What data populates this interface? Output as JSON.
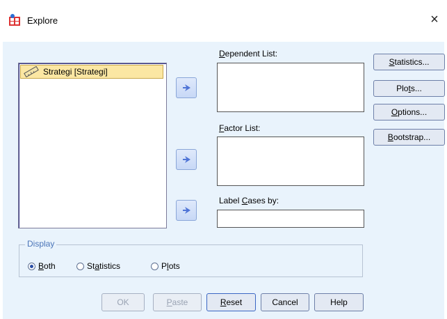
{
  "window": {
    "title": "Explore",
    "close_glyph": "×"
  },
  "variables": [
    {
      "label": "Strategi [Strategi]",
      "icon": "scale-ruler-icon"
    }
  ],
  "fields": {
    "dependent_label_pre": "D",
    "dependent_label_post": "ependent List:",
    "factor_label_pre": "F",
    "factor_label_post": "actor List:",
    "label_cases_pre": "Label ",
    "label_cases_ul": "C",
    "label_cases_post": "ases by:"
  },
  "side_buttons": {
    "statistics_pre": "",
    "statistics_ul": "S",
    "statistics_post": "tatistics...",
    "plots_pre": "Plo",
    "plots_ul": "t",
    "plots_post": "s...",
    "options_pre": "",
    "options_ul": "O",
    "options_post": "ptions...",
    "bootstrap_pre": "",
    "bootstrap_ul": "B",
    "bootstrap_post": "ootstrap..."
  },
  "display": {
    "legend": "Display",
    "both_ul": "B",
    "both_post": "oth",
    "statistics_pre": "St",
    "statistics_ul": "a",
    "statistics_post": "tistics",
    "plots_pre": "P",
    "plots_ul": "l",
    "plots_post": "ots",
    "selected": "Both"
  },
  "bottom_buttons": {
    "ok": "OK",
    "paste_ul": "P",
    "paste_post": "aste",
    "reset_ul": "R",
    "reset_post": "eset",
    "cancel": "Cancel",
    "help": "Help"
  },
  "colors": {
    "accent": "#4f74d6",
    "selected_row": "#fbe7a3",
    "client_bg": "#e9f3fc"
  }
}
